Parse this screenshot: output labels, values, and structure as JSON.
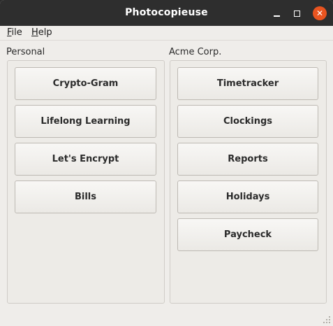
{
  "window": {
    "title": "Photocopieuse"
  },
  "titlebar_buttons": {
    "minimize_icon": "minimize-icon",
    "maximize_icon": "maximize-icon",
    "close_icon": "close-icon",
    "close_glyph": "✕",
    "close_color": "#e95420"
  },
  "menubar": {
    "file": {
      "underline": "F",
      "rest": "ile"
    },
    "help": {
      "underline": "H",
      "rest": "elp"
    }
  },
  "groups": {
    "personal": {
      "label": "Personal",
      "buttons": [
        "Crypto-Gram",
        "Lifelong Learning",
        "Let's Encrypt",
        "Bills"
      ]
    },
    "acme": {
      "label": "Acme Corp.",
      "buttons": [
        "Timetracker",
        "Clockings",
        "Reports",
        "Holidays",
        "Paycheck"
      ]
    }
  }
}
